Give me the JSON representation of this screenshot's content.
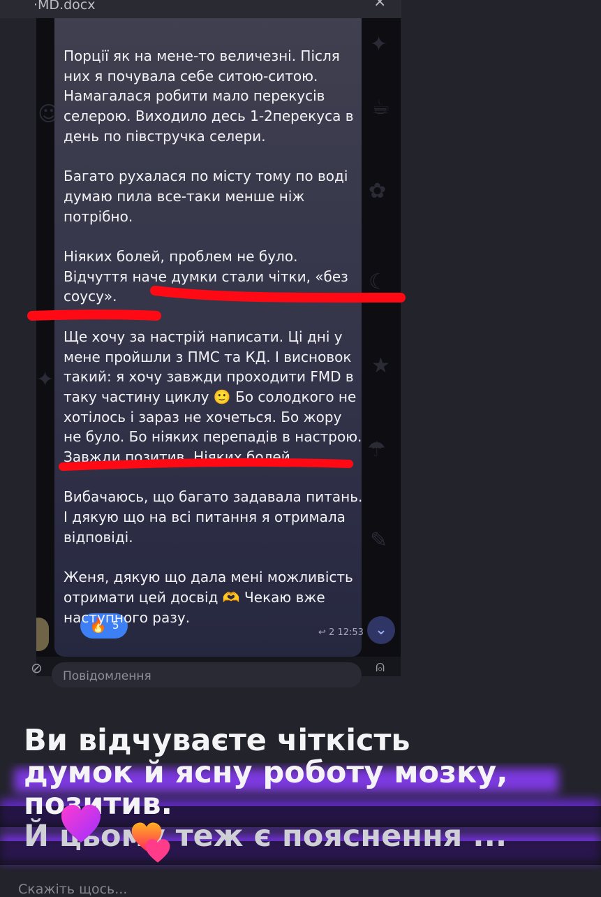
{
  "file_bar": {
    "filename": "·MD.docx",
    "close_glyph": "×"
  },
  "message": {
    "paragraphs": [
      "Порції як на мене-то величезні. Після\nних я почувала себе ситою-ситою.\nНамагалася робити мало перекусів\nселерою. Виходило десь 1-2перекуса в\nдень по півстручка селери.",
      "Багато рухалася по місту тому по воді\nдумаю пила все-таки менше ніж\nпотрібно.",
      "Ніяких болей, проблем не було.\nВідчуття наче думки стали чітки, «без\nсоусу».",
      "Ще хочу за настрій написати. Ці дні у\nмене пройшли з ПМС та КД. І висновок\nтакий: я хочу завжди проходити FMD в\nтаку частину циклу 🙂 Бо солодкого не\nхотілось і зараз не хочеться. Бо жору\nне було. Бо ніяких перепадів в настрою.\nЗавжди позитив. Ніяких болей.",
      "Вибачаюсь, що багато задавала питань.\nІ дякую що на всі питання я отримала\nвідповіді.",
      "Женя, дякую що дала мені можливість\nотримати цей досвід 🫶 Чекаю вже\nнаступного разу."
    ],
    "reaction": {
      "emoji": "🔥",
      "count": "5"
    },
    "reply_count": "2",
    "time": "12:53"
  },
  "input": {
    "placeholder": "Повідомлення"
  },
  "caption": {
    "line1": "Ви відчуваєте чіткість",
    "line2": "думок й ясну роботу мозку,",
    "line3": "позитив.",
    "line4": "Й цьому теж є пояснення ..."
  },
  "story_reply_placeholder": "Скажіть щось...",
  "colors": {
    "marker_red": "#ff0a14",
    "reaction_blue": "#3d7ff5",
    "caption_glow": "#8c3cff"
  }
}
